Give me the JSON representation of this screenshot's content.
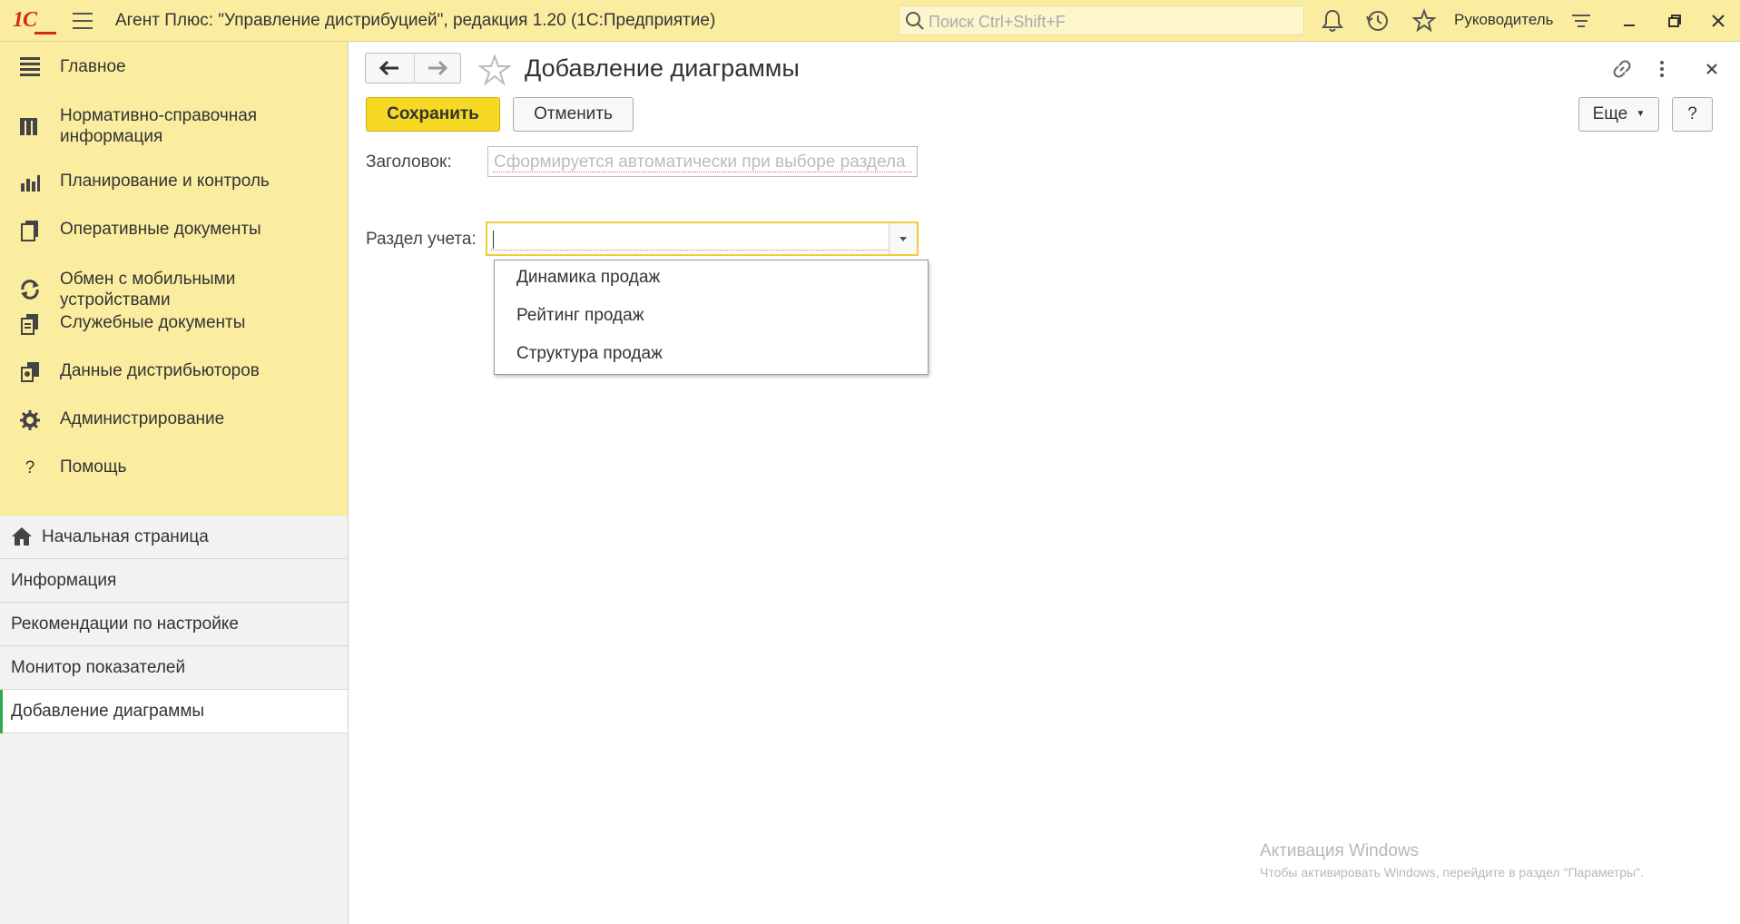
{
  "titlebar": {
    "logo": "1С",
    "app_title": "Агент Плюс: \"Управление дистрибуцией\", редакция 1.20  (1С:Предприятие)",
    "search_placeholder": "Поиск Ctrl+Shift+F",
    "user": "Руководитель"
  },
  "sidebar": {
    "sections": [
      {
        "label": "Главное",
        "icon": "menu-lines-icon"
      },
      {
        "label": "Нормативно-справочная информация",
        "icon": "catalog-icon"
      },
      {
        "label": "Планирование и контроль",
        "icon": "bar-chart-icon"
      },
      {
        "label": "Оперативные документы",
        "icon": "documents-icon"
      },
      {
        "label": "Обмен с мобильными устройствами",
        "icon": "sync-icon"
      },
      {
        "label": "Служебные документы",
        "icon": "service-docs-icon"
      },
      {
        "label": "Данные дистрибьюторов",
        "icon": "distributor-data-icon"
      },
      {
        "label": "Администрирование",
        "icon": "gear-icon"
      },
      {
        "label": "Помощь",
        "icon": "help-icon"
      }
    ],
    "open_windows": [
      {
        "label": "Начальная страница"
      },
      {
        "label": "Информация"
      },
      {
        "label": "Рекомендации по настройке"
      },
      {
        "label": "Монитор показателей"
      },
      {
        "label": "Добавление диаграммы"
      }
    ]
  },
  "form": {
    "title": "Добавление диаграммы",
    "save_label": "Сохранить",
    "cancel_label": "Отменить",
    "more_label": "Еще",
    "help_label": "?",
    "title_field_label": "Заголовок:",
    "title_field_placeholder": "Сформируется автоматически при выборе раздела",
    "section_field_label": "Раздел учета:",
    "section_field_value": "",
    "dropdown_options": [
      "Динамика продаж",
      "Рейтинг продаж",
      "Структура продаж"
    ]
  },
  "watermark": {
    "line1": "Активация Windows",
    "line2": "Чтобы активировать Windows, перейдите в раздел \"Параметры\"."
  },
  "colors": {
    "accent_yellow": "#fbeda0",
    "save_button": "#f5d923",
    "active_marker": "#2eaa4a",
    "logo_red": "#d42a1f"
  }
}
